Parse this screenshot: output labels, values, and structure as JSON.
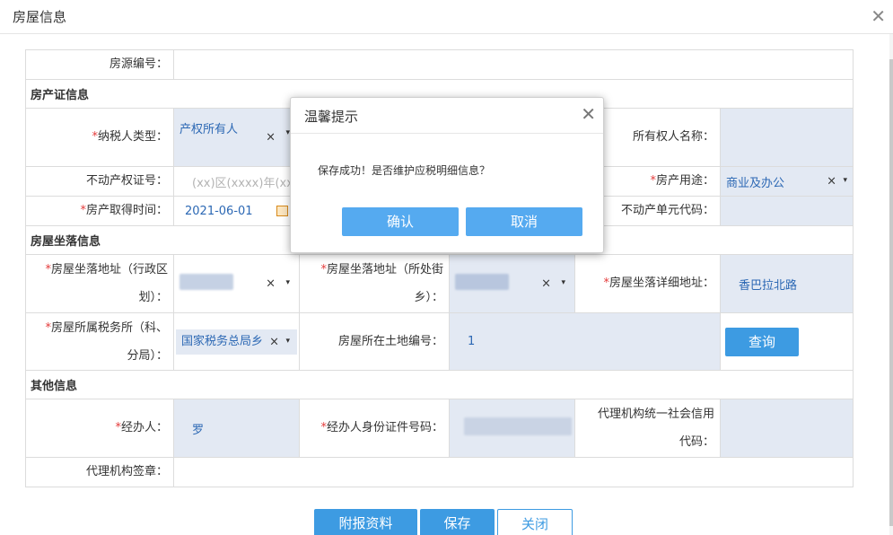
{
  "window": {
    "title": "房屋信息",
    "close_icon": "close-icon"
  },
  "form": {
    "fangyuan_label": "房源编号：",
    "section_cert": "房产证信息",
    "taxpayer_type_label": "纳税人类型：",
    "taxpayer_type_value": "产权所有人",
    "owner_name_label": "所有权人名称：",
    "realty_cert_label": "不动产权证号：",
    "realty_cert_placeholder": "(xx)区(xxxx)年(xx",
    "house_use_label": "房产用途：",
    "house_use_value": "商业及办公",
    "acquire_time_label": "房产取得时间：",
    "acquire_time_value": "2021-06-01",
    "unit_code_label": "不动产单元代码：",
    "section_location": "房屋坐落信息",
    "addr_district_label_1": "房屋坐落地址（行政区",
    "addr_district_label_2": "划）：",
    "addr_street_label_1": "房屋坐落地址（所处街",
    "addr_street_label_2": "乡）：",
    "addr_detail_label": "房屋坐落详细地址：",
    "addr_detail_value": "香巴拉北路",
    "tax_office_label_1": "房屋所属税务所（科、",
    "tax_office_label_2": "分局）：",
    "tax_office_value": "国家税务总局乡",
    "land_no_label": "房屋所在土地编号：",
    "land_no_value": "1",
    "query_button": "查询",
    "section_other": "其他信息",
    "handler_label": "经办人：",
    "handler_value": "罗",
    "handler_id_label": "经办人身份证件号码：",
    "agency_credit_label_1": "代理机构统一社会信用",
    "agency_credit_label_2": "代码：",
    "agency_seal_label": "代理机构签章：",
    "clear_mark": "×",
    "caret_mark": "▾",
    "required_mark": "*"
  },
  "buttons": {
    "attach": "附报资料",
    "save": "保存",
    "close": "关闭"
  },
  "dialog": {
    "title": "温馨提示",
    "message": "保存成功！是否维护应税明细信息？",
    "confirm": "确认",
    "cancel": "取消"
  }
}
